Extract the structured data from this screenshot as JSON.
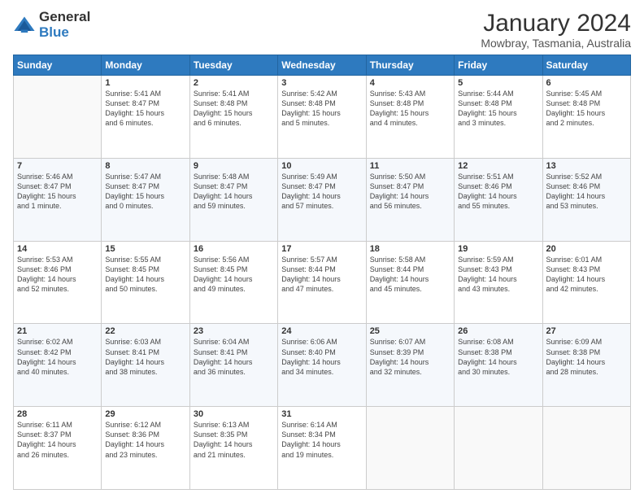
{
  "logo": {
    "general": "General",
    "blue": "Blue"
  },
  "header": {
    "title": "January 2024",
    "subtitle": "Mowbray, Tasmania, Australia"
  },
  "days_of_week": [
    "Sunday",
    "Monday",
    "Tuesday",
    "Wednesday",
    "Thursday",
    "Friday",
    "Saturday"
  ],
  "weeks": [
    [
      {
        "day": "",
        "info": ""
      },
      {
        "day": "1",
        "info": "Sunrise: 5:41 AM\nSunset: 8:47 PM\nDaylight: 15 hours\nand 6 minutes."
      },
      {
        "day": "2",
        "info": "Sunrise: 5:41 AM\nSunset: 8:48 PM\nDaylight: 15 hours\nand 6 minutes."
      },
      {
        "day": "3",
        "info": "Sunrise: 5:42 AM\nSunset: 8:48 PM\nDaylight: 15 hours\nand 5 minutes."
      },
      {
        "day": "4",
        "info": "Sunrise: 5:43 AM\nSunset: 8:48 PM\nDaylight: 15 hours\nand 4 minutes."
      },
      {
        "day": "5",
        "info": "Sunrise: 5:44 AM\nSunset: 8:48 PM\nDaylight: 15 hours\nand 3 minutes."
      },
      {
        "day": "6",
        "info": "Sunrise: 5:45 AM\nSunset: 8:48 PM\nDaylight: 15 hours\nand 2 minutes."
      }
    ],
    [
      {
        "day": "7",
        "info": "Sunrise: 5:46 AM\nSunset: 8:47 PM\nDaylight: 15 hours\nand 1 minute."
      },
      {
        "day": "8",
        "info": "Sunrise: 5:47 AM\nSunset: 8:47 PM\nDaylight: 15 hours\nand 0 minutes."
      },
      {
        "day": "9",
        "info": "Sunrise: 5:48 AM\nSunset: 8:47 PM\nDaylight: 14 hours\nand 59 minutes."
      },
      {
        "day": "10",
        "info": "Sunrise: 5:49 AM\nSunset: 8:47 PM\nDaylight: 14 hours\nand 57 minutes."
      },
      {
        "day": "11",
        "info": "Sunrise: 5:50 AM\nSunset: 8:47 PM\nDaylight: 14 hours\nand 56 minutes."
      },
      {
        "day": "12",
        "info": "Sunrise: 5:51 AM\nSunset: 8:46 PM\nDaylight: 14 hours\nand 55 minutes."
      },
      {
        "day": "13",
        "info": "Sunrise: 5:52 AM\nSunset: 8:46 PM\nDaylight: 14 hours\nand 53 minutes."
      }
    ],
    [
      {
        "day": "14",
        "info": "Sunrise: 5:53 AM\nSunset: 8:46 PM\nDaylight: 14 hours\nand 52 minutes."
      },
      {
        "day": "15",
        "info": "Sunrise: 5:55 AM\nSunset: 8:45 PM\nDaylight: 14 hours\nand 50 minutes."
      },
      {
        "day": "16",
        "info": "Sunrise: 5:56 AM\nSunset: 8:45 PM\nDaylight: 14 hours\nand 49 minutes."
      },
      {
        "day": "17",
        "info": "Sunrise: 5:57 AM\nSunset: 8:44 PM\nDaylight: 14 hours\nand 47 minutes."
      },
      {
        "day": "18",
        "info": "Sunrise: 5:58 AM\nSunset: 8:44 PM\nDaylight: 14 hours\nand 45 minutes."
      },
      {
        "day": "19",
        "info": "Sunrise: 5:59 AM\nSunset: 8:43 PM\nDaylight: 14 hours\nand 43 minutes."
      },
      {
        "day": "20",
        "info": "Sunrise: 6:01 AM\nSunset: 8:43 PM\nDaylight: 14 hours\nand 42 minutes."
      }
    ],
    [
      {
        "day": "21",
        "info": "Sunrise: 6:02 AM\nSunset: 8:42 PM\nDaylight: 14 hours\nand 40 minutes."
      },
      {
        "day": "22",
        "info": "Sunrise: 6:03 AM\nSunset: 8:41 PM\nDaylight: 14 hours\nand 38 minutes."
      },
      {
        "day": "23",
        "info": "Sunrise: 6:04 AM\nSunset: 8:41 PM\nDaylight: 14 hours\nand 36 minutes."
      },
      {
        "day": "24",
        "info": "Sunrise: 6:06 AM\nSunset: 8:40 PM\nDaylight: 14 hours\nand 34 minutes."
      },
      {
        "day": "25",
        "info": "Sunrise: 6:07 AM\nSunset: 8:39 PM\nDaylight: 14 hours\nand 32 minutes."
      },
      {
        "day": "26",
        "info": "Sunrise: 6:08 AM\nSunset: 8:38 PM\nDaylight: 14 hours\nand 30 minutes."
      },
      {
        "day": "27",
        "info": "Sunrise: 6:09 AM\nSunset: 8:38 PM\nDaylight: 14 hours\nand 28 minutes."
      }
    ],
    [
      {
        "day": "28",
        "info": "Sunrise: 6:11 AM\nSunset: 8:37 PM\nDaylight: 14 hours\nand 26 minutes."
      },
      {
        "day": "29",
        "info": "Sunrise: 6:12 AM\nSunset: 8:36 PM\nDaylight: 14 hours\nand 23 minutes."
      },
      {
        "day": "30",
        "info": "Sunrise: 6:13 AM\nSunset: 8:35 PM\nDaylight: 14 hours\nand 21 minutes."
      },
      {
        "day": "31",
        "info": "Sunrise: 6:14 AM\nSunset: 8:34 PM\nDaylight: 14 hours\nand 19 minutes."
      },
      {
        "day": "",
        "info": ""
      },
      {
        "day": "",
        "info": ""
      },
      {
        "day": "",
        "info": ""
      }
    ]
  ]
}
